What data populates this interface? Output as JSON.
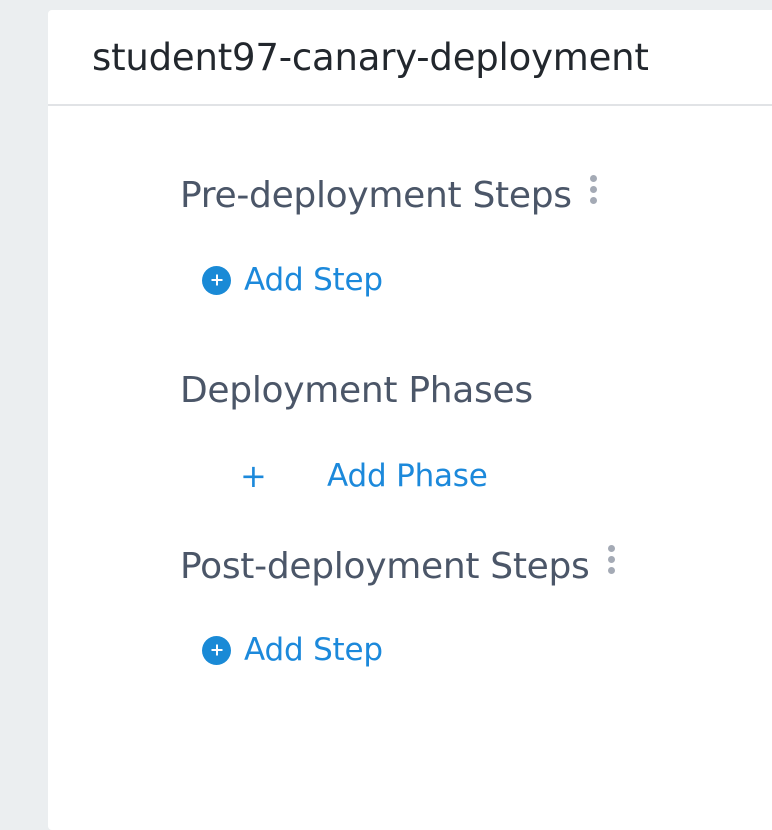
{
  "workflow": {
    "title": "student97-canary-deployment"
  },
  "sections": {
    "pre": {
      "title": "Pre-deployment Steps",
      "add_label": "Add Step"
    },
    "phases": {
      "title": "Deployment Phases",
      "add_symbol": "+",
      "add_label": "Add Phase"
    },
    "post": {
      "title": "Post-deployment Steps",
      "add_label": "Add Step"
    }
  },
  "icons": {
    "section_menu": "more-vertical-icon",
    "add_step": "plus-circle-icon",
    "add_phase": "plus-icon"
  },
  "colors": {
    "accent": "#1a8ad6",
    "title_text": "#22272d",
    "section_text": "#4b5668",
    "background": "#ebeef0"
  }
}
